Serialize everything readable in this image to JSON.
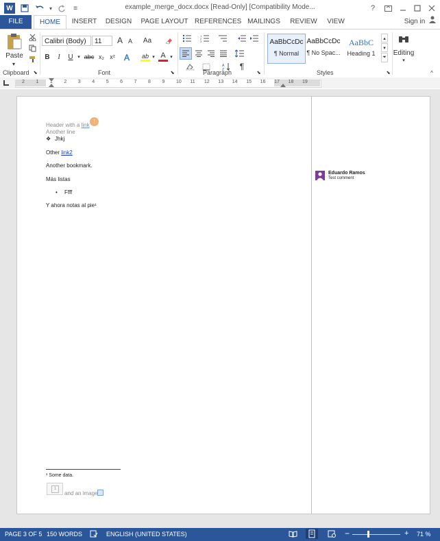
{
  "window": {
    "title": "example_merge_docx.docx [Read-Only] [Compatibility Mode...",
    "help_icon": "?",
    "sign_in": "Sign in"
  },
  "tabs": [
    "FILE",
    "HOME",
    "INSERT",
    "DESIGN",
    "PAGE LAYOUT",
    "REFERENCES",
    "MAILINGS",
    "REVIEW",
    "VIEW"
  ],
  "ribbon": {
    "paste_label": "Paste",
    "font_name": "Calibri (Body)",
    "font_size": "11",
    "font_grow": "A",
    "font_shrink": "A",
    "change_case": "Aa",
    "bold": "B",
    "italic": "I",
    "underline": "U",
    "strikethrough": "abc",
    "subscript": "x₂",
    "superscript": "x²",
    "highlight": "ab",
    "font_color": "A",
    "pilcrow": "¶",
    "styles": [
      {
        "preview": "AaBbCcDc",
        "name": "¶ Normal"
      },
      {
        "preview": "AaBbCcDc",
        "name": "¶ No Spac..."
      },
      {
        "preview": "AaBbC",
        "name": "Heading 1"
      }
    ],
    "editing_label": "Editing",
    "groups": [
      "Clipboard",
      "Font",
      "Paragraph",
      "Styles"
    ]
  },
  "ruler": {
    "numbers": [
      "2",
      "1",
      "1",
      "2",
      "3",
      "4",
      "5",
      "6",
      "7",
      "8",
      "9",
      "10",
      "11",
      "12",
      "13",
      "14",
      "15",
      "16",
      "17",
      "18",
      "19"
    ]
  },
  "document": {
    "header_text": "Header with a ",
    "header_link": "link",
    "another_line": "Another line",
    "bullet_symbol": "❖",
    "bullet_text": "Jhkj",
    "other_text": "Other ",
    "other_link": "link2",
    "bookmark_text": "Another bookmark.",
    "mas_listas": "Más listas",
    "list_bullet": "•",
    "list_item": "Ffff",
    "footnote_ref": "Y ahora notas al pie¹",
    "footnote": "¹ Some data.",
    "footer_text": "and an image",
    "footer_image_label": "1"
  },
  "comment": {
    "author": "Eduardo Ramos",
    "text": "Test comment"
  },
  "status": {
    "page": "PAGE 3 OF 5",
    "words": "150 WORDS",
    "language": "ENGLISH (UNITED STATES)",
    "zoom_minus": "−",
    "zoom_plus": "+",
    "zoom": "71 %"
  },
  "colors": {
    "accent": "#2b579a",
    "link": "#1d3cd6",
    "comment_avatar": "#7d3c98"
  }
}
